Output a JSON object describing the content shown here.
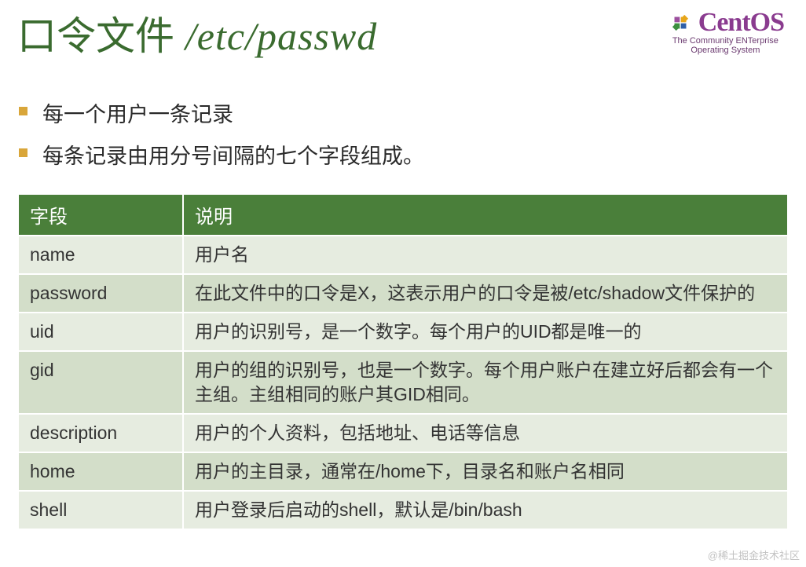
{
  "title_cn": "口令文件",
  "title_path": "/etc/passwd",
  "logo": {
    "name": "CentOS",
    "tagline1": "The Community ENTerprise",
    "tagline2": "Operating System"
  },
  "bullets": [
    "每一个用户一条记录",
    "每条记录由用分号间隔的七个字段组成。"
  ],
  "table": {
    "headers": [
      "字段",
      "说明"
    ],
    "rows": [
      {
        "field": "name",
        "desc": "用户名"
      },
      {
        "field": "password",
        "desc": "在此文件中的口令是X，这表示用户的口令是被/etc/shadow文件保护的"
      },
      {
        "field": "uid",
        "desc": "用户的识别号，是一个数字。每个用户的UID都是唯一的"
      },
      {
        "field": "gid",
        "desc": "用户的组的识别号，也是一个数字。每个用户账户在建立好后都会有一个主组。主组相同的账户其GID相同。"
      },
      {
        "field": "description",
        "desc": "用户的个人资料，包括地址、电话等信息"
      },
      {
        "field": "home",
        "desc": "用户的主目录，通常在/home下，目录名和账户名相同"
      },
      {
        "field": "shell",
        "desc": "用户登录后启动的shell，默认是/bin/bash"
      }
    ]
  },
  "watermark": "@稀土掘金技术社区"
}
